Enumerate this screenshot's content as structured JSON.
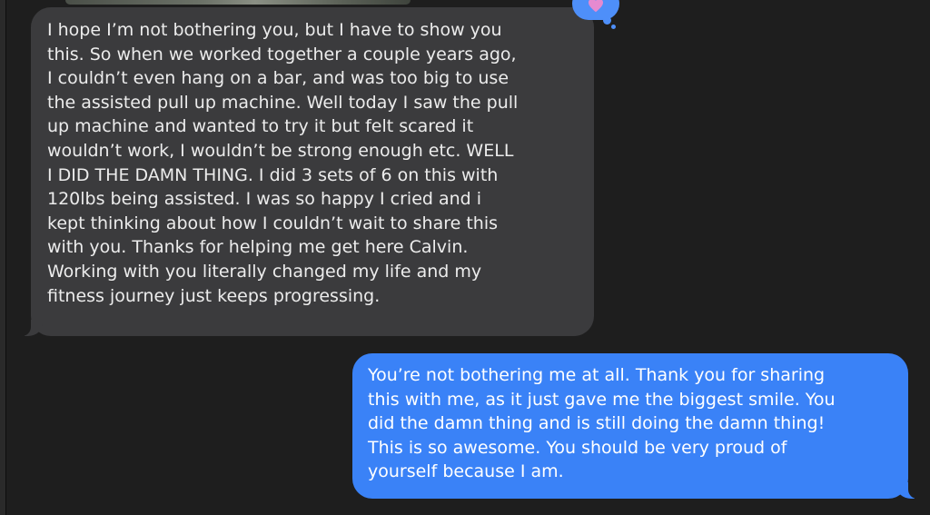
{
  "conversation": {
    "messages": [
      {
        "direction": "incoming",
        "text": "I hope I’m not bothering you, but I have to show you\nthis. So when we worked together a couple years ago,\nI couldn’t even hang on a bar, and was too big to use\nthe assisted pull up machine. Well today I saw the pull\nup machine and wanted to try it but felt scared it\nwouldn’t work, I wouldn’t be strong enough etc. WELL\nI DID THE DAMN THING. I did 3 sets of 6 on this with\n120lbs being assisted. I was so happy I cried and i\nkept thinking about how I couldn’t wait to share this\nwith you. Thanks for helping me get here Calvin.\nWorking with you literally changed my life and my\nfitness journey just keeps progressing."
      },
      {
        "direction": "outgoing",
        "text": "You’re not bothering me at all. Thank you for sharing\nthis with me, as it just gave me the biggest smile. You\ndid the damn thing and is still doing the damn thing!\nThis is so awesome. You should be very proud of\nyourself because I am."
      }
    ],
    "tapback": {
      "icon": "heart-icon",
      "color": "#e58ad0",
      "bubble_color": "#4e8ff9"
    }
  },
  "theme": {
    "background": "#1e1e1e",
    "incoming_bubble": "#3b3b3d",
    "outgoing_bubble": "#3a82f7"
  }
}
